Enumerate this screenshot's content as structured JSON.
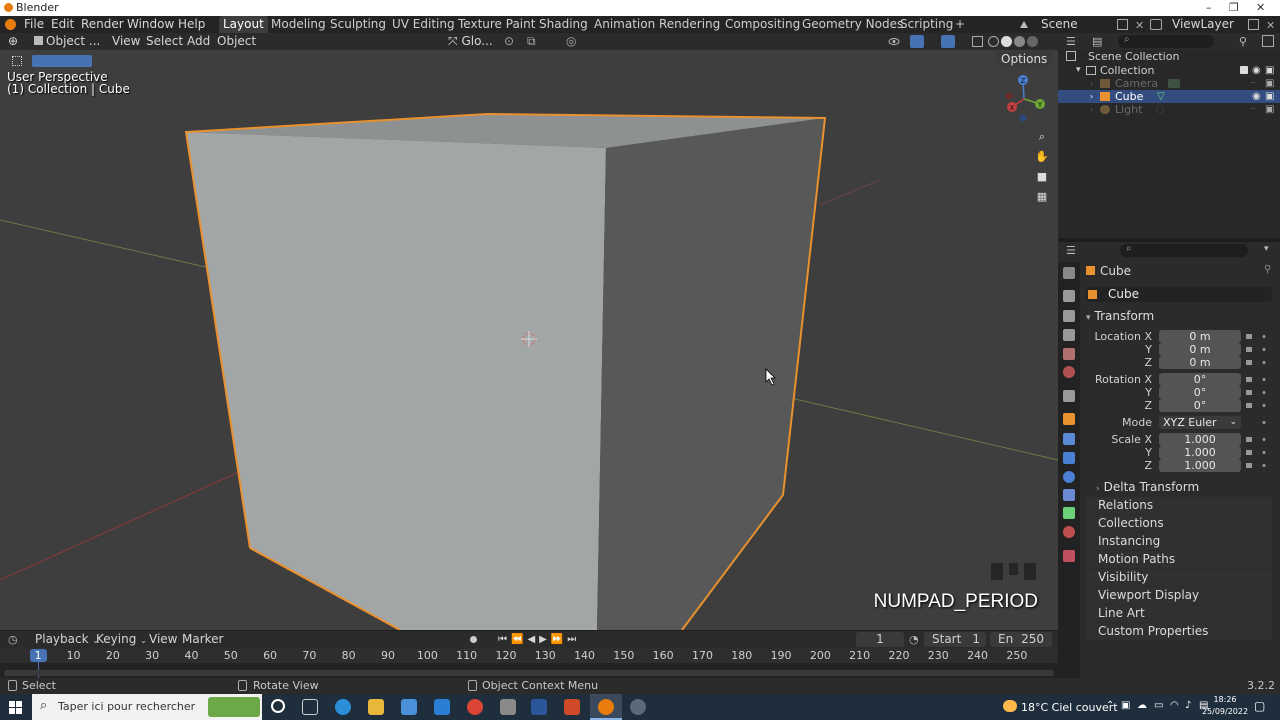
{
  "window": {
    "title": "Blender",
    "controls": [
      "–",
      "❐",
      "✕"
    ]
  },
  "menu": {
    "file": "File",
    "edit": "Edit",
    "render": "Render",
    "window": "Window",
    "help": "Help"
  },
  "workspaces": [
    "Layout",
    "Modeling",
    "Sculpting",
    "UV Editing",
    "Texture Paint",
    "Shading",
    "Animation",
    "Rendering",
    "Compositing",
    "Geometry Nodes",
    "Scripting"
  ],
  "active_workspace": "Layout",
  "add_workspace": "+",
  "scene": {
    "name": "Scene",
    "view_layer": "ViewLayer"
  },
  "viewport_header": {
    "mode": "Object ...",
    "view": "View",
    "select": "Select",
    "add": "Add",
    "object": "Object",
    "orientation": "Glo...",
    "options": "Options"
  },
  "viewport": {
    "perspective": "User Perspective",
    "collection_info": "(1) Collection | Cube",
    "key_overlay": "NUMPAD_PERIOD"
  },
  "gizmo": {
    "x": "X",
    "y": "Y",
    "z": "Z"
  },
  "outliner": {
    "root": "Scene Collection",
    "collection": "Collection",
    "items": [
      {
        "name": "Camera",
        "active": false
      },
      {
        "name": "Cube",
        "active": true
      },
      {
        "name": "Light",
        "active": false
      }
    ]
  },
  "properties": {
    "object_name": "Cube",
    "datablock_name": "Cube",
    "transform_label": "Transform",
    "location_label": "Location X",
    "rotation_label": "Rotation X",
    "scale_label": "Scale X",
    "axis_y": "Y",
    "axis_z": "Z",
    "location": [
      "0 m",
      "0 m",
      "0 m"
    ],
    "rotation": [
      "0°",
      "0°",
      "0°"
    ],
    "mode_label": "Mode",
    "mode_value": "XYZ Euler",
    "scale": [
      "1.000",
      "1.000",
      "1.000"
    ],
    "delta_transform": "Delta Transform",
    "panels": [
      "Relations",
      "Collections",
      "Instancing",
      "Motion Paths",
      "Visibility",
      "Viewport Display",
      "Line Art",
      "Custom Properties"
    ]
  },
  "timeline": {
    "playback": "Playback",
    "keying": "Keying",
    "view": "View",
    "marker": "Marker",
    "current_frame": "1",
    "start_label": "Start",
    "start": "1",
    "end_label": "En",
    "end": "250",
    "ticks": [
      "1",
      "10",
      "20",
      "30",
      "40",
      "50",
      "60",
      "70",
      "80",
      "90",
      "100",
      "110",
      "120",
      "130",
      "140",
      "150",
      "160",
      "170",
      "180",
      "190",
      "200",
      "210",
      "220",
      "230",
      "240",
      "250"
    ]
  },
  "status": {
    "select": "Select",
    "rotate": "Rotate View",
    "context": "Object Context Menu",
    "version": "3.2.2"
  },
  "taskbar": {
    "search_placeholder": "Taper ici pour rechercher",
    "weather": "18°C  Ciel couvert",
    "time": "18:26",
    "date": "25/09/2022"
  }
}
